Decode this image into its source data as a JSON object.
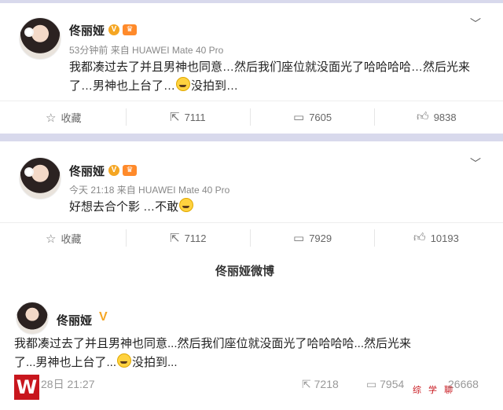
{
  "post1": {
    "author": "佟丽娅",
    "time": "53分钟前",
    "source": "来自 HUAWEI Mate 40 Pro",
    "text_line1": "我都凑过去了并且男神也同意…然后我们座位就没面光了哈哈哈哈…然后光来",
    "text_line2_a": "了…男神也上台了…",
    "text_line2_b": "没拍到…",
    "actions": {
      "favorite": "收藏",
      "repost": "7111",
      "comment": "7605",
      "like": "9838"
    }
  },
  "post2": {
    "author": "佟丽娅",
    "time": "今天 21:18",
    "source": "来自 HUAWEI Mate 40 Pro",
    "text_a": "好想去合个影 …不敢",
    "actions": {
      "favorite": "收藏",
      "repost": "7112",
      "comment": "7929",
      "like": "10193"
    }
  },
  "section_title": "佟丽娅微博",
  "repost": {
    "author": "佟丽娅",
    "text_line1": "我都凑过去了并且男神也同意...然后我们座位就没面光了哈哈哈哈...然后光来",
    "text_line2_a": "了...男神也上台了...",
    "text_line2_b": "没拍到...",
    "date": "28日 21:27",
    "repost_count": "7218",
    "comment_count": "7954",
    "like_count": "26668"
  },
  "watermark": {
    "logo": "W",
    "text": "综 学 聊"
  },
  "icons": {
    "chevron": "chevron-down-icon",
    "star": "star-icon",
    "repost": "repost-icon",
    "comment": "comment-icon",
    "like": "thumbs-up-icon"
  }
}
